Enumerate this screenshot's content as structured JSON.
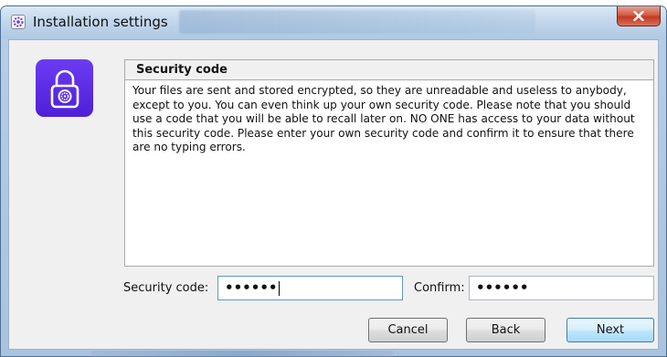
{
  "window": {
    "title": "Installation settings"
  },
  "panel": {
    "heading": "Security code",
    "body": "Your files are sent and stored encrypted, so they are unreadable and useless to anybody, except to you. You can even think up your own security code. Please note that you should use a code that you will be able to recall later on. NO ONE has access to your data without this security code. Please enter your own security code and confirm it to ensure that there are no typing errors."
  },
  "fields": {
    "security_code_label": "Security code:",
    "security_code_value": "••••••",
    "confirm_label": "Confirm:",
    "confirm_value": "••••••"
  },
  "buttons": {
    "cancel": "Cancel",
    "back": "Back",
    "next": "Next"
  },
  "icons": {
    "app": "gear-icon",
    "close": "close-icon",
    "tile": "lock-icon"
  },
  "colors": {
    "tile": "#5a2ae6",
    "close": "#c8452c",
    "default_button": "#3c7fb1"
  }
}
